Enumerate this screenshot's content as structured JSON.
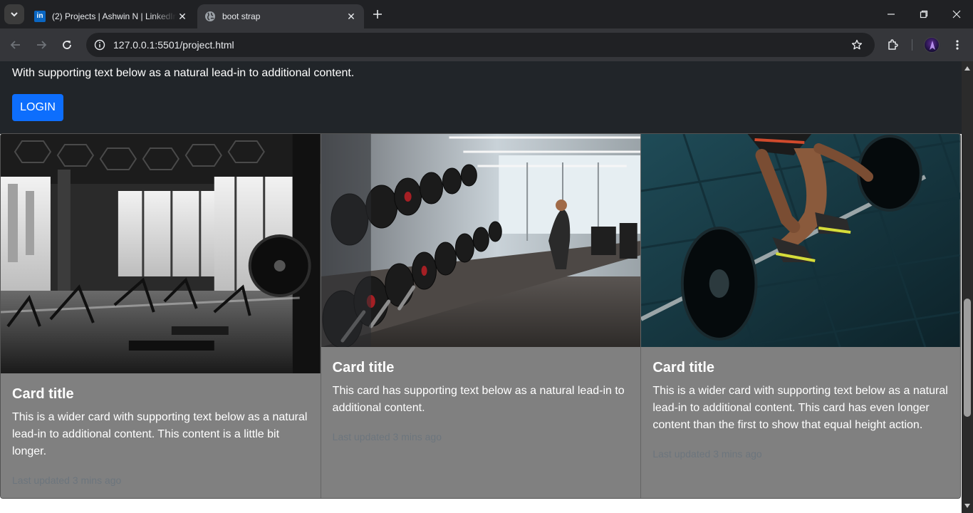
{
  "browser": {
    "tabs": [
      {
        "title": "(2) Projects | Ashwin N | LinkedIn",
        "favicon": "linkedin-icon",
        "active": false
      },
      {
        "title": "boot strap",
        "favicon": "globe-icon",
        "active": true
      }
    ],
    "linkedin_favicon_text": "in",
    "url": "127.0.0.1:5501/project.html"
  },
  "page": {
    "hero_text": "With supporting text below as a natural lead-in to additional content.",
    "login_label": "LOGIN",
    "cards": [
      {
        "image": "gym-interior-monochrome",
        "title": "Card title",
        "text": "This is a wider card with supporting text below as a natural lead-in to additional content. This content is a little bit longer.",
        "updated": "Last updated 3 mins ago"
      },
      {
        "image": "dumbbell-rack",
        "title": "Card title",
        "text": "This card has supporting text below as a natural lead-in to additional content.",
        "updated": "Last updated 3 mins ago"
      },
      {
        "image": "barbell-deadlift",
        "title": "Card title",
        "text": "This is a wider card with supporting text below as a natural lead-in to additional content. This card has even longer content than the first to show that equal height action.",
        "updated": "Last updated 3 mins ago"
      }
    ]
  },
  "colors": {
    "hero_bg": "#212529",
    "button_primary": "#0d6efd",
    "card_bg": "#808080",
    "muted_text": "#6c757d"
  }
}
